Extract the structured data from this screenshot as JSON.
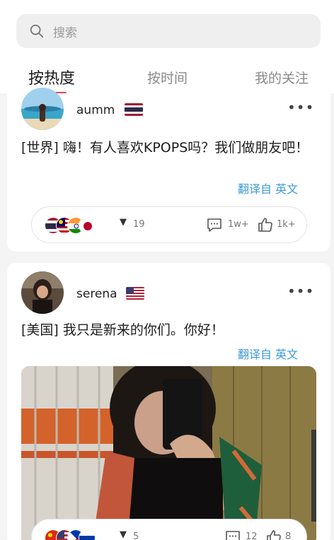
{
  "search": {
    "placeholder": "搜索",
    "icon": "search-icon"
  },
  "tabs": [
    {
      "label": "按热度",
      "active": true
    },
    {
      "label": "按时间",
      "active": false
    },
    {
      "label": "我的关注",
      "active": false
    }
  ],
  "posts": [
    {
      "username": "aumm",
      "flag": "thailand",
      "text": "[世界] 嗨！有人喜欢KPOPS吗？我们做朋友吧！",
      "translate_label": "翻译自 英文",
      "reaction_flags": [
        "thailand",
        "malaysia",
        "india",
        "japan"
      ],
      "reaction_count": "19",
      "comments": "1w+",
      "likes": "1k+"
    },
    {
      "username": "serena",
      "flag": "usa",
      "text": "[美国] 我只是新来的你们。你好！",
      "translate_label": "翻译自 英文",
      "reaction_flags": [
        "china",
        "usa",
        "philippines",
        "russia"
      ],
      "reaction_count": "5",
      "comments": "12",
      "likes": "8"
    }
  ],
  "colors": {
    "accent": "#e0484c",
    "link": "#3a9bd6"
  }
}
